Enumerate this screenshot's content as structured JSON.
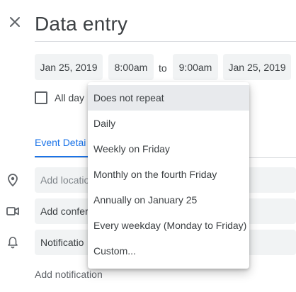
{
  "header": {
    "title": "Data entry",
    "close_icon": "close-icon"
  },
  "datetime": {
    "start_date": "Jan 25, 2019",
    "start_time": "8:00am",
    "to_label": "to",
    "end_time": "9:00am",
    "end_date": "Jan 25, 2019"
  },
  "all_day": {
    "label": "All day",
    "checked": false
  },
  "tabs": {
    "event_details": "Event Detai"
  },
  "fields": {
    "location_placeholder": "Add locatio",
    "conference_label": "Add confer",
    "notification_label": "Notificatio",
    "add_notification": "Add notification"
  },
  "icons": {
    "location": "location-pin-icon",
    "conference": "video-camera-icon",
    "notification": "bell-icon"
  },
  "repeat_menu": {
    "items": [
      "Does not repeat",
      "Daily",
      "Weekly on Friday",
      "Monthly on the fourth Friday",
      "Annually on January 25",
      "Every weekday (Monday to Friday)",
      "Custom..."
    ],
    "selected_index": 0
  },
  "colors": {
    "accent": "#1a73e8",
    "chip_bg": "#f1f3f4",
    "text": "#3c4043",
    "selected_bg": "#e8eaed"
  }
}
